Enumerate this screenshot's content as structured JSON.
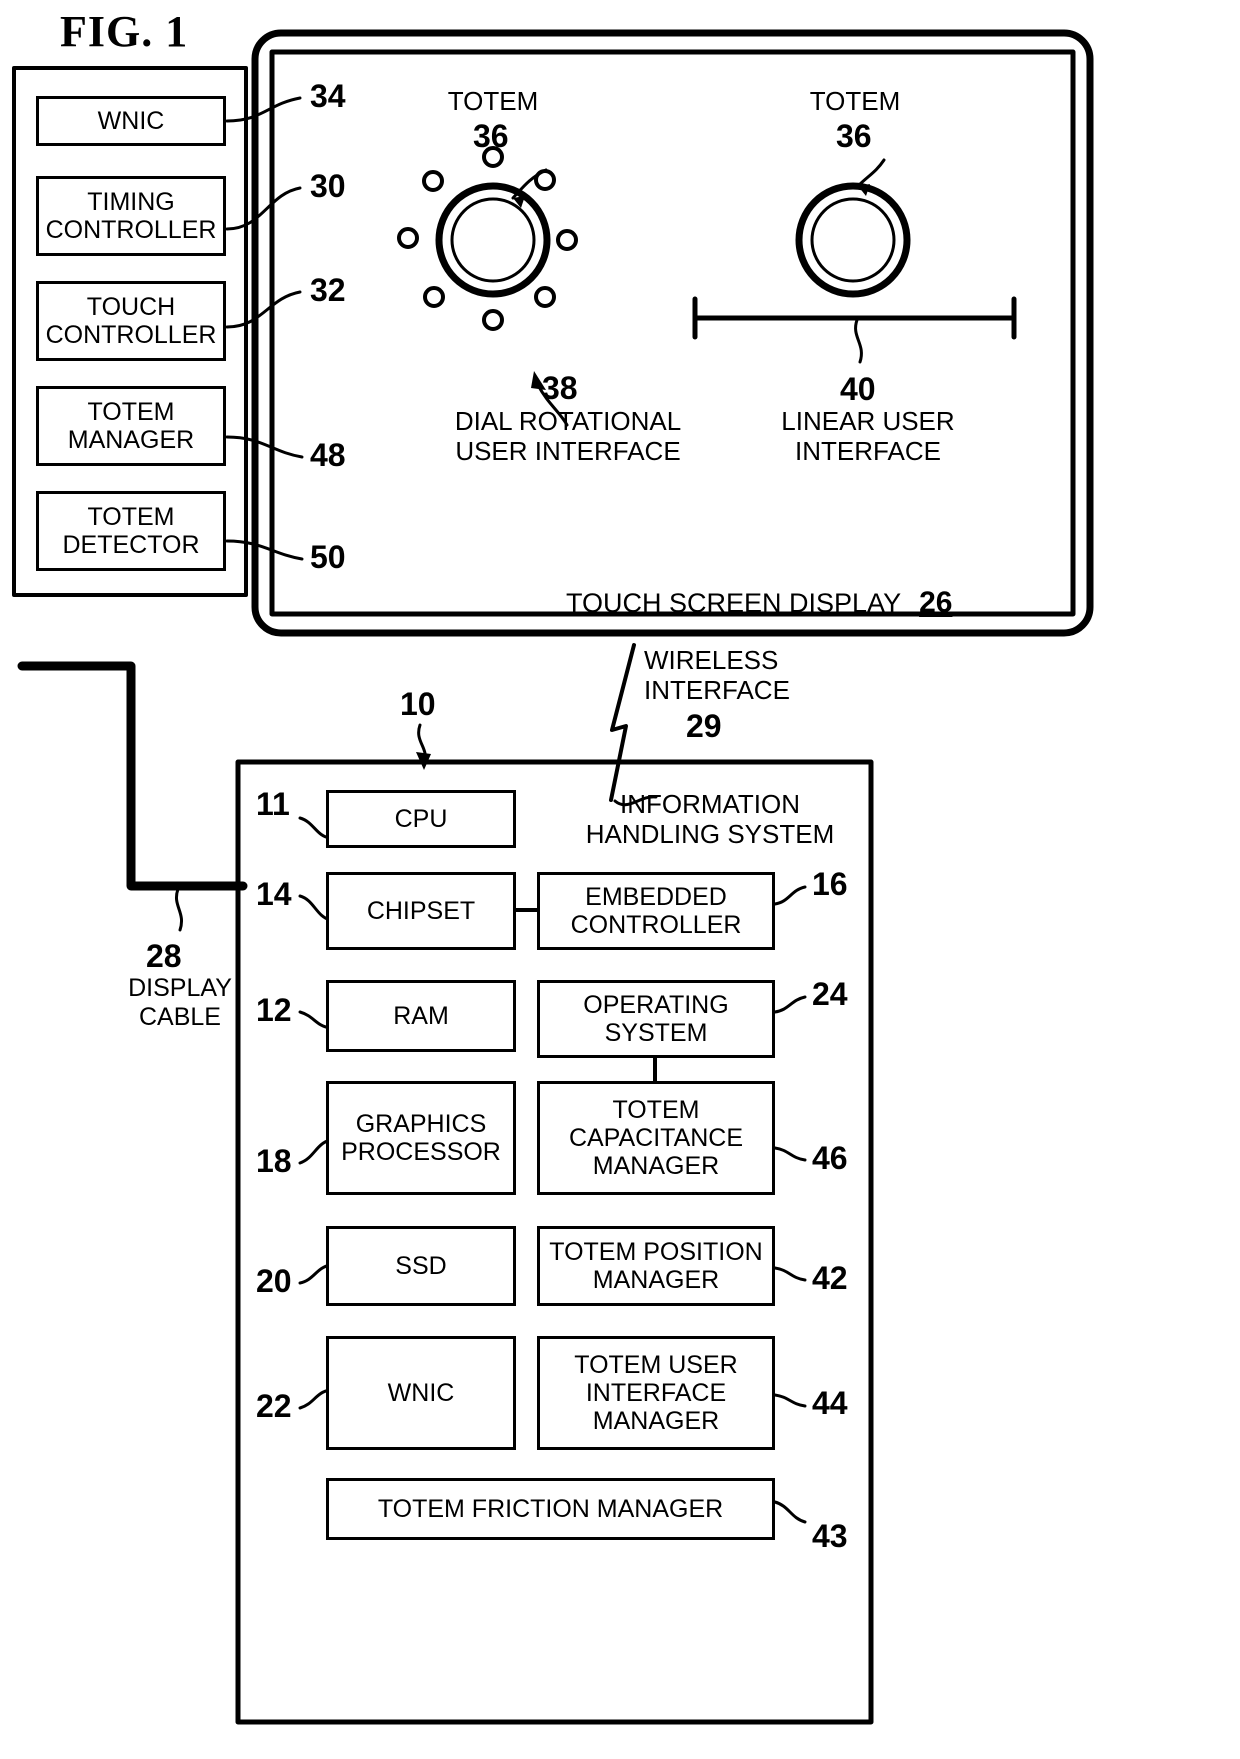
{
  "figure": {
    "title": "FIG. 1"
  },
  "display_panel": {
    "blocks": [
      {
        "label": "WNIC",
        "ref": "34"
      },
      {
        "label": "TIMING\nCONTROLLER",
        "ref": "30"
      },
      {
        "label": "TOUCH\nCONTROLLER",
        "ref": "32"
      },
      {
        "label": "TOTEM\nMANAGER",
        "ref": "48"
      },
      {
        "label": "TOTEM\nDETECTOR",
        "ref": "50"
      }
    ],
    "screen_label": "TOUCH SCREEN DISPLAY",
    "screen_ref": "26",
    "cable_ref": "28",
    "cable_label": "DISPLAY\nCABLE"
  },
  "totems": {
    "left": {
      "name": "TOTEM",
      "ref": "36",
      "ui_ref": "38",
      "ui_label": "DIAL ROTATIONAL\nUSER INTERFACE",
      "dots": 8
    },
    "right": {
      "name": "TOTEM",
      "ref": "36",
      "ui_ref": "40",
      "ui_label": "LINEAR USER\nINTERFACE"
    }
  },
  "wireless": {
    "label": "WIRELESS\nINTERFACE",
    "ref": "29"
  },
  "ihs": {
    "ref": "10",
    "title": "INFORMATION\nHANDLING SYSTEM",
    "left_column": [
      {
        "label": "CPU",
        "ref": "11"
      },
      {
        "label": "CHIPSET",
        "ref": "14"
      },
      {
        "label": "RAM",
        "ref": "12"
      },
      {
        "label": "GRAPHICS\nPROCESSOR",
        "ref": "18"
      },
      {
        "label": "SSD",
        "ref": "20"
      },
      {
        "label": "WNIC",
        "ref": "22"
      }
    ],
    "right_column": [
      {
        "label": "EMBEDDED\nCONTROLLER",
        "ref": "16"
      },
      {
        "label": "OPERATING\nSYSTEM",
        "ref": "24"
      },
      {
        "label": "TOTEM\nCAPACITANCE\nMANAGER",
        "ref": "46"
      },
      {
        "label": "TOTEM POSITION\nMANAGER",
        "ref": "42"
      },
      {
        "label": "TOTEM USER\nINTERFACE\nMANAGER",
        "ref": "44"
      }
    ],
    "wide_block": {
      "label": "TOTEM FRICTION MANAGER",
      "ref": "43"
    }
  }
}
